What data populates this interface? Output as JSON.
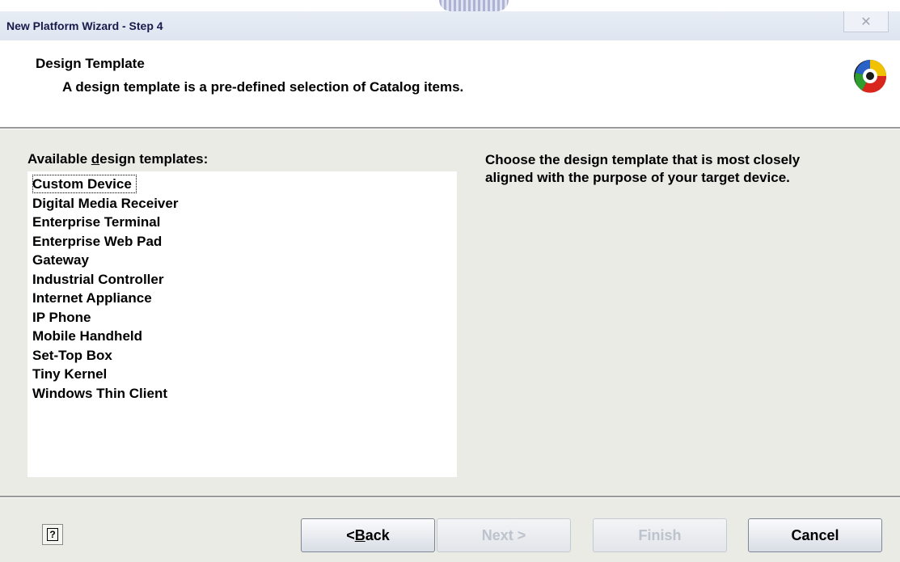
{
  "window": {
    "title": "New Platform Wizard - Step 4",
    "close_glyph": "✕"
  },
  "header": {
    "title": "Design Template",
    "subtitle": "A design template is a pre-defined selection of Catalog items.",
    "logo_icon": "wizard-logo-icon"
  },
  "list": {
    "label_prefix": "Available ",
    "label_accel": "d",
    "label_suffix": "esign templates:",
    "items": [
      "Custom Device",
      "Digital Media Receiver",
      "Enterprise Terminal",
      "Enterprise Web Pad",
      "Gateway",
      "Industrial Controller",
      "Internet Appliance",
      "IP Phone",
      "Mobile Handheld",
      "Set-Top Box",
      "Tiny Kernel",
      "Windows Thin Client"
    ],
    "selected_index": 0
  },
  "description": "Choose the design template that is most closely aligned with the purpose of your target device.",
  "footer": {
    "help_glyph": "?",
    "back_prefix": "< ",
    "back_accel": "B",
    "back_suffix": "ack",
    "next_label": "Next >",
    "finish_label": "Finish",
    "cancel_label": "Cancel"
  }
}
